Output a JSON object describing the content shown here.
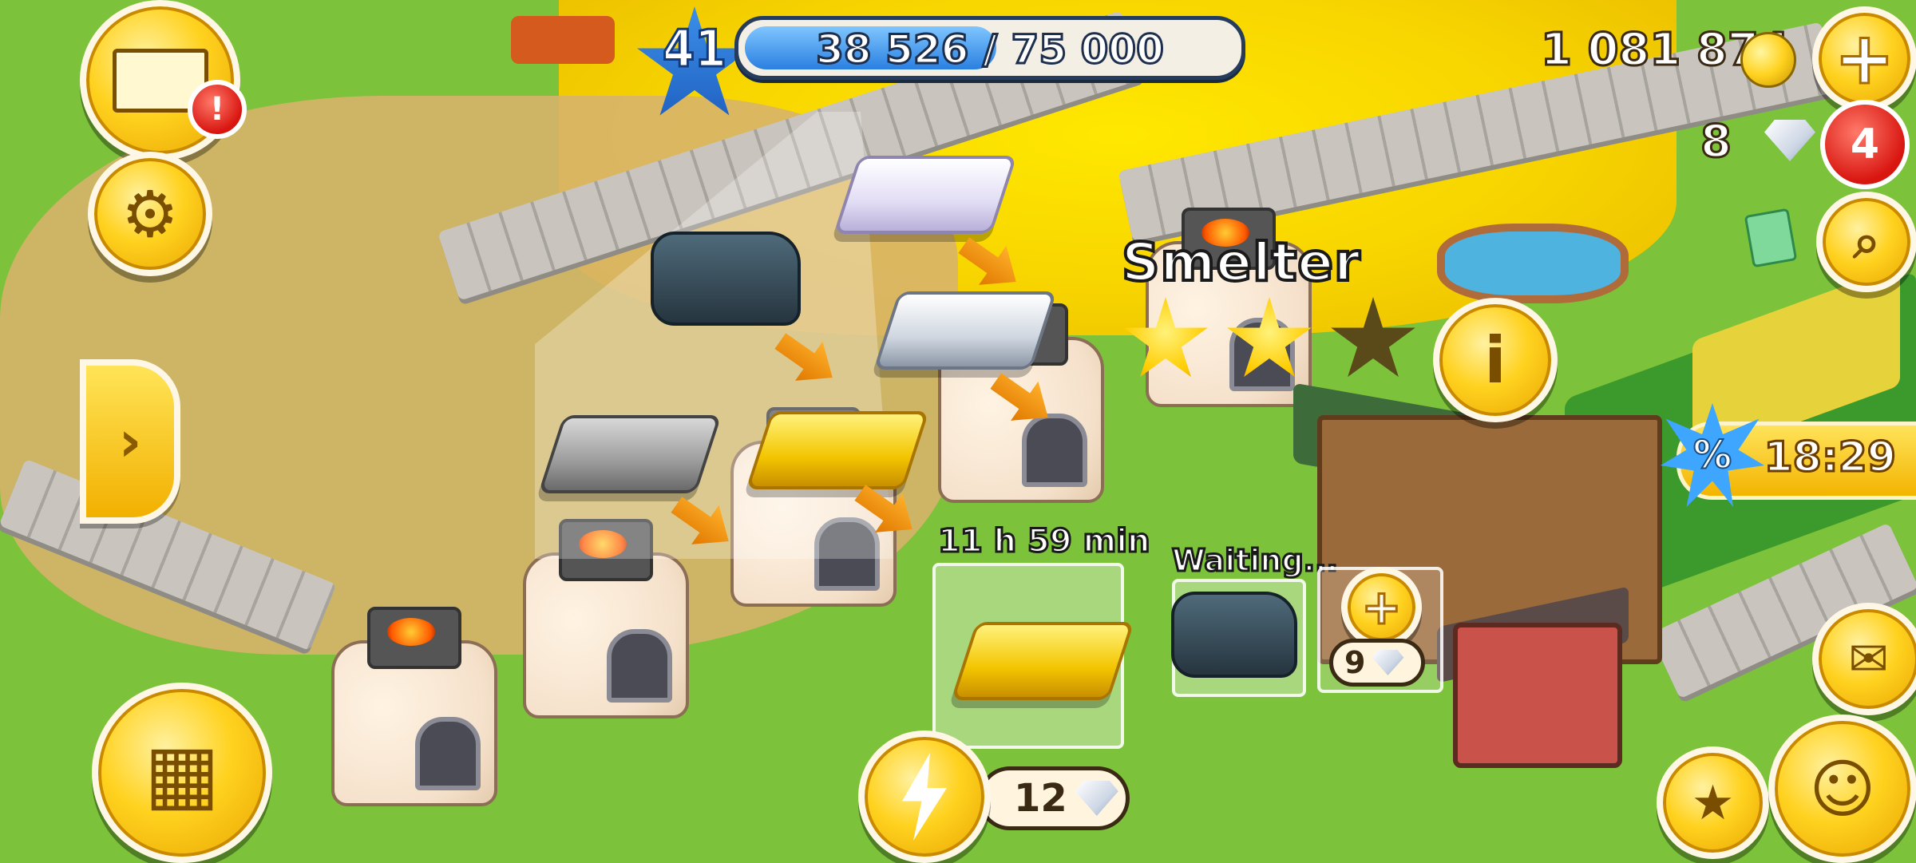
{
  "hud": {
    "level": "41",
    "xp_text": "38 526 / 75 000",
    "xp_progress": 0.5137,
    "coins": "1 081 874",
    "diamonds": "8",
    "diamond_badge_count": "4",
    "mail_alert": "!"
  },
  "smelter": {
    "title": "Smelter",
    "stars_earned": 2,
    "stars_total": 3,
    "products": [
      "platinum-bar",
      "iron-ore",
      "silver-bar",
      "gold-bar",
      "iron-bar"
    ],
    "current_product": "gold-bar",
    "timer": "11 h 59 min",
    "waiting_label": "Waiting...",
    "waiting_product": "iron-ore",
    "unlock_slot_cost": "9",
    "speed_up_cost": "12"
  },
  "sale": {
    "icon": "%",
    "timer": "18:29"
  },
  "icons": {
    "mail": "mail-icon",
    "settings": "gear-icon",
    "expand": "chevron-right-icon",
    "shop": "cash-register-icon",
    "add_coins": "plus-icon",
    "search": "magnifier-icon",
    "info": "info-icon",
    "speed_up": "lightning-icon",
    "map": "map-icon",
    "cards": "cards-icon",
    "friends": "friends-icon"
  },
  "colors": {
    "gold": "#ffd21f",
    "xp_blue": "#2a7fe0",
    "badge_red": "#d8150f"
  }
}
